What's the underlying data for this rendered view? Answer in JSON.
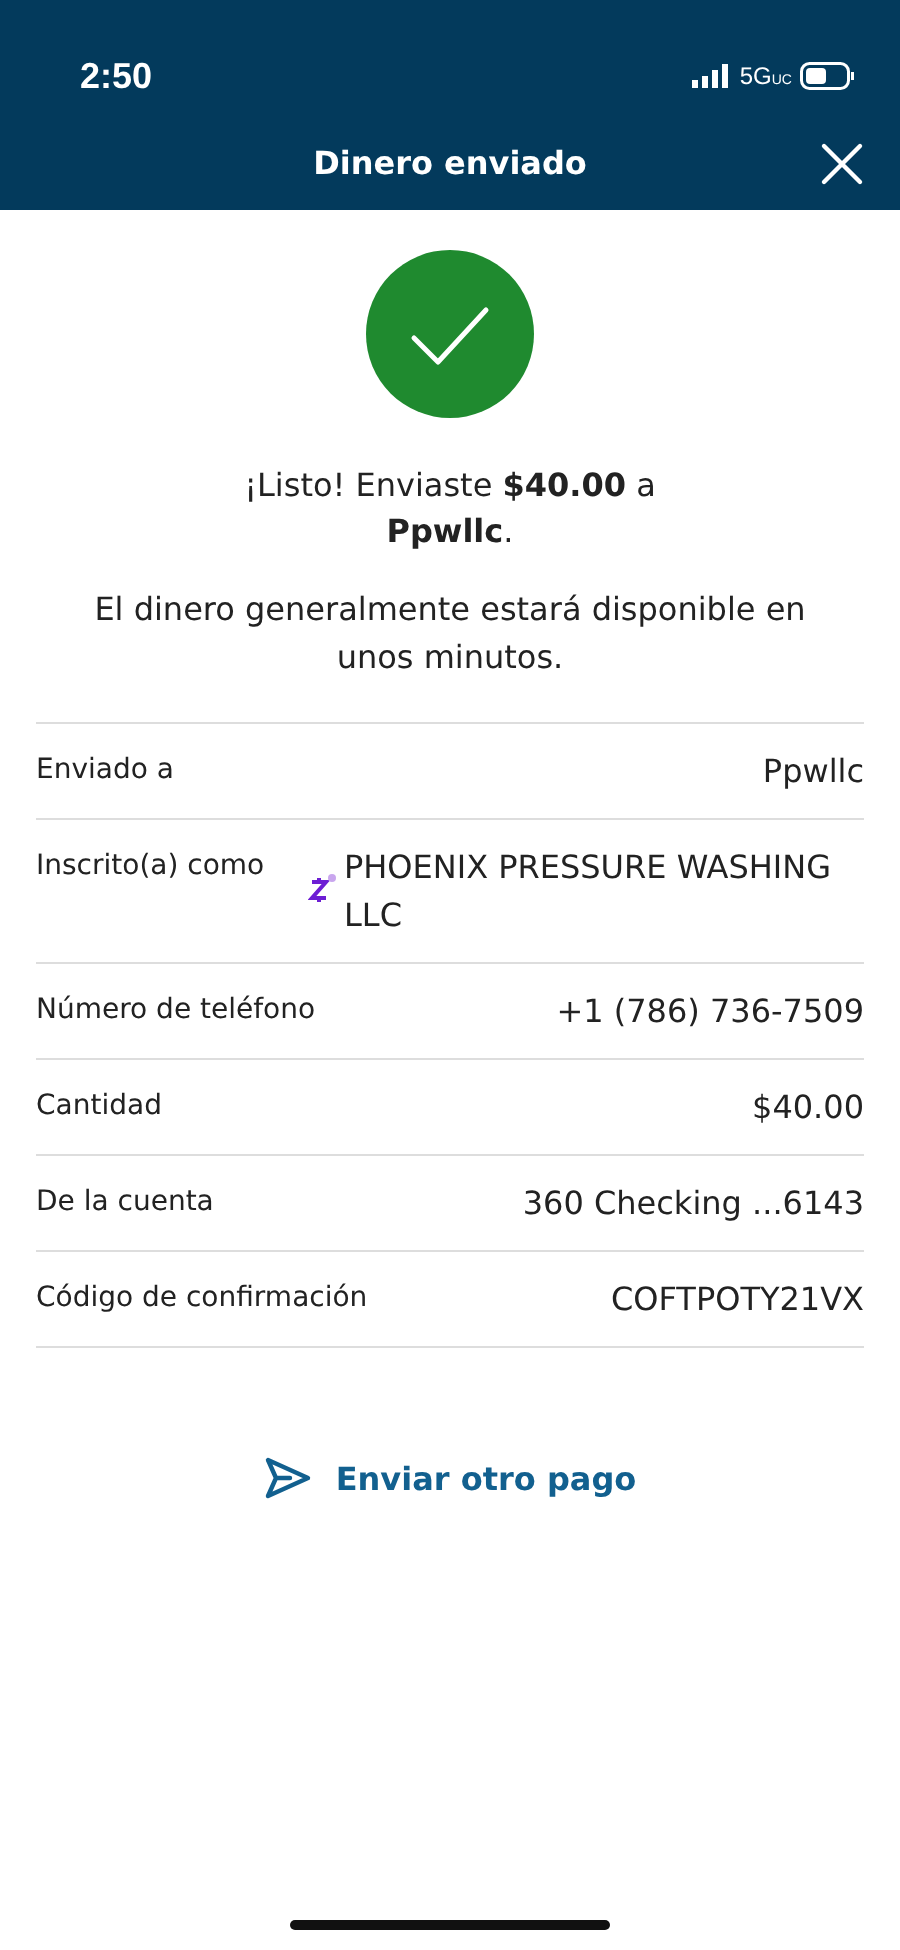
{
  "status_bar": {
    "time": "2:50",
    "network": "5G",
    "network_sub": "UC"
  },
  "header": {
    "title": "Dinero enviado"
  },
  "message": {
    "text": "¡Listo! Enviaste **$40.00** a **Ppwllc**.",
    "note": "El dinero generalmente estará disponible en unos minutos."
  },
  "details": [
    {
      "label": "Enviado a",
      "value": "Ppwllc",
      "kind": "plain"
    },
    {
      "label": "Inscrito(a) como",
      "value": "PHOENIX PRESSURE WASHING LLC",
      "kind": "enrolled"
    },
    {
      "label": "Número de teléfono",
      "value": "+1 (786) 736-7509",
      "kind": "plain"
    },
    {
      "label": "Cantidad",
      "value": "$40.00",
      "kind": "plain"
    },
    {
      "label": "De la cuenta",
      "value": "360 Checking ...6143",
      "kind": "plain"
    },
    {
      "label": "Código de confirmación",
      "value": "COFTPOTY21VX",
      "kind": "plain"
    }
  ],
  "action": {
    "label": "Enviar otro pago"
  }
}
